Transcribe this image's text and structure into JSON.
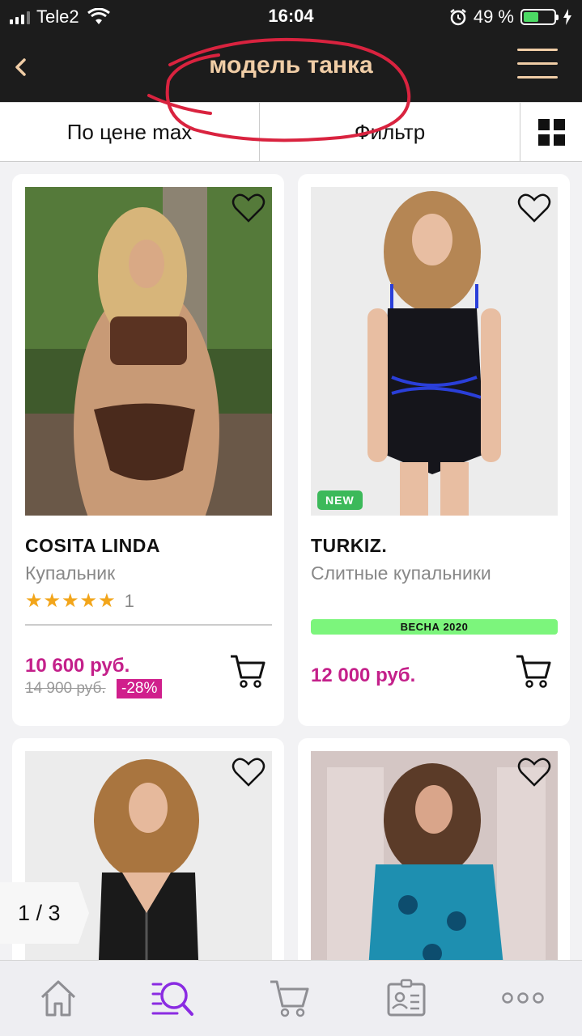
{
  "status_bar": {
    "carrier": "Tele2",
    "time": "16:04",
    "battery_percent": "49 %",
    "battery_level": 0.49
  },
  "header": {
    "title": "модель танка"
  },
  "toolbar": {
    "sort_label": "По цене max",
    "filter_label": "Фильтр"
  },
  "products": [
    {
      "brand": "COSITA LINDA",
      "category": "Купальник",
      "rating_stars": "★★★★★",
      "rating_count": "1",
      "price": "10 600 руб.",
      "old_price": "14 900 руб.",
      "discount": "-28%"
    },
    {
      "brand": "TURKIZ.",
      "category": "Слитные купальники",
      "badge_new": "NEW",
      "season": "ВЕСНА 2020",
      "price": "12 000 руб."
    },
    {},
    {}
  ],
  "page_indicator": "1 / 3",
  "colors": {
    "header_bg": "#1c1c1c",
    "accent_gold": "#f0cda6",
    "price_magenta": "#c4208a",
    "nav_active": "#8a2be2",
    "scribble_red": "#d9233f"
  },
  "bottom_nav": {
    "items": [
      "home-icon",
      "search-icon",
      "cart-icon",
      "profile-icon",
      "more-icon"
    ],
    "active": "search-icon"
  }
}
